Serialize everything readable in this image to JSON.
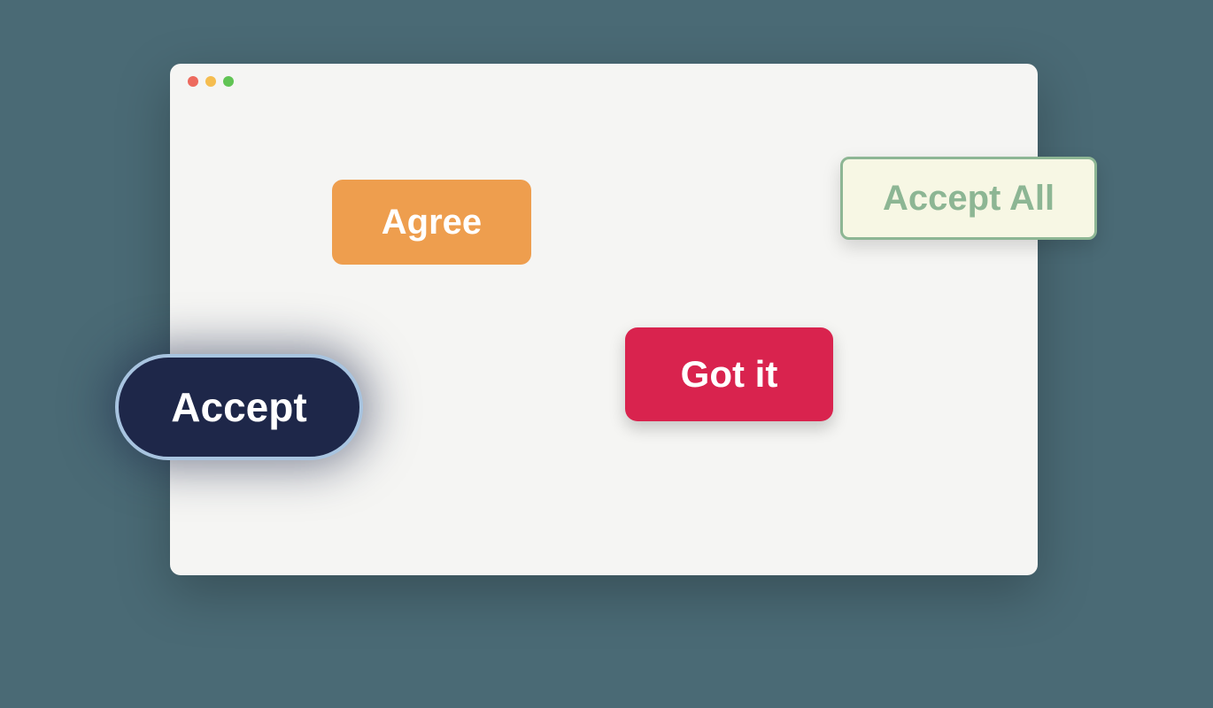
{
  "buttons": {
    "agree": "Agree",
    "accept_all": "Accept All",
    "got_it": "Got it",
    "accept": "Accept"
  }
}
